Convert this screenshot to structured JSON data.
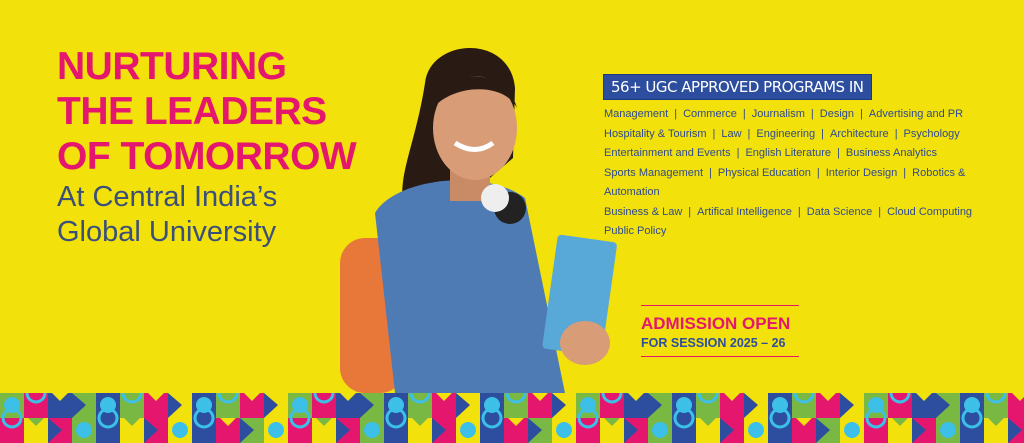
{
  "headline": {
    "line1": "NURTURING",
    "line2": "THE LEADERS",
    "line3": "OF TOMORROW"
  },
  "subheadline": {
    "line1": "At Central India’s",
    "line2": "Global University"
  },
  "programs": {
    "badge": "56+ UGC APPROVED PROGRAMS IN",
    "items": [
      "Management",
      "Commerce",
      "Journalism",
      "Design",
      "Advertising and PR",
      "Hospitality & Tourism",
      "Law",
      "Engineering",
      "Architecture",
      "Psychology",
      "Entertainment and Events",
      "English Literature",
      "Business Analytics",
      "Sports Management",
      "Physical Education",
      "Interior Design",
      "Robotics & Automation",
      "Business & Law",
      "Artifical Intelligence",
      "Data Science",
      "Cloud Computing",
      "Public Policy"
    ]
  },
  "admission": {
    "title": "ADMISSION OPEN",
    "session": "FOR SESSION 2025 – 26"
  },
  "colors": {
    "background": "#f3e10c",
    "pink": "#e4166e",
    "blue": "#2d4e9e",
    "green": "#7ab844",
    "cyan": "#3cc0e8"
  }
}
